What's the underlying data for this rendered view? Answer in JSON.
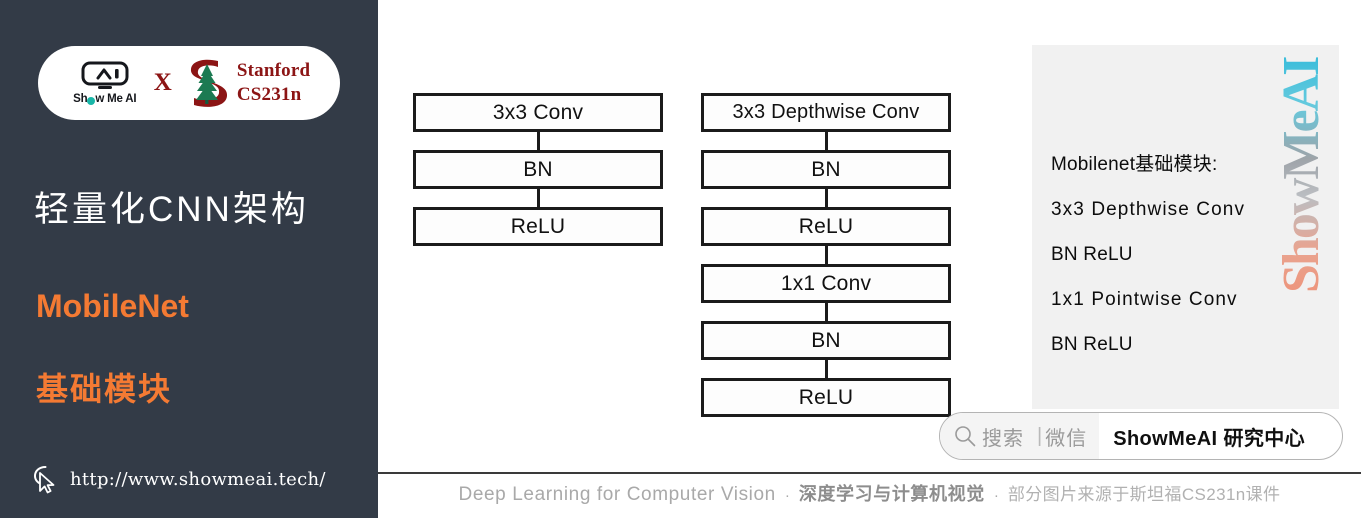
{
  "sidebar": {
    "logo": {
      "showmeai_wordmark_pre": "Sh",
      "showmeai_wordmark_post": "w Me AI",
      "cross": "X",
      "stanford_line1": "Stanford",
      "stanford_line2": "CS231n",
      "robot_icon": "robot-face-icon",
      "stanford_icon": "stanford-tree-s-icon"
    },
    "title": "轻量化CNN架构",
    "subtitle_en": "MobileNet",
    "subtitle_cn": "基础模块",
    "cursor_icon": "mouse-cursor-icon",
    "url": "http://www.showmeai.tech/",
    "accent_color": "#f47a33",
    "background_color": "#333b47"
  },
  "diagram": {
    "left_column": {
      "name": "standard-convolution-block",
      "nodes": [
        "3x3 Conv",
        "BN",
        "ReLU"
      ]
    },
    "right_column": {
      "name": "depthwise-separable-convolution-block",
      "nodes": [
        "3x3 Depthwise Conv",
        "BN",
        "ReLU",
        "1x1 Conv",
        "BN",
        "ReLU"
      ]
    }
  },
  "info_panel": {
    "lines": [
      "Mobilenet基础模块:",
      "3x3  Depthwise  Conv",
      "BN ReLU",
      "1x1  Pointwise  Conv",
      "BN ReLU"
    ],
    "background_color": "#f1f1f1"
  },
  "watermark": {
    "text": "ShowMeAI"
  },
  "search_bar": {
    "search_icon": "magnifier-icon",
    "placeholder": "搜索",
    "separator": "|",
    "channel": "微信",
    "brand": "ShowMeAI 研究中心"
  },
  "footer": {
    "english": "Deep Learning for Computer Vision",
    "dot1": "·",
    "chinese_bold": "深度学习与计算机视觉",
    "dot2": "·",
    "chinese_note": "部分图片来源于斯坦福CS231n课件"
  }
}
